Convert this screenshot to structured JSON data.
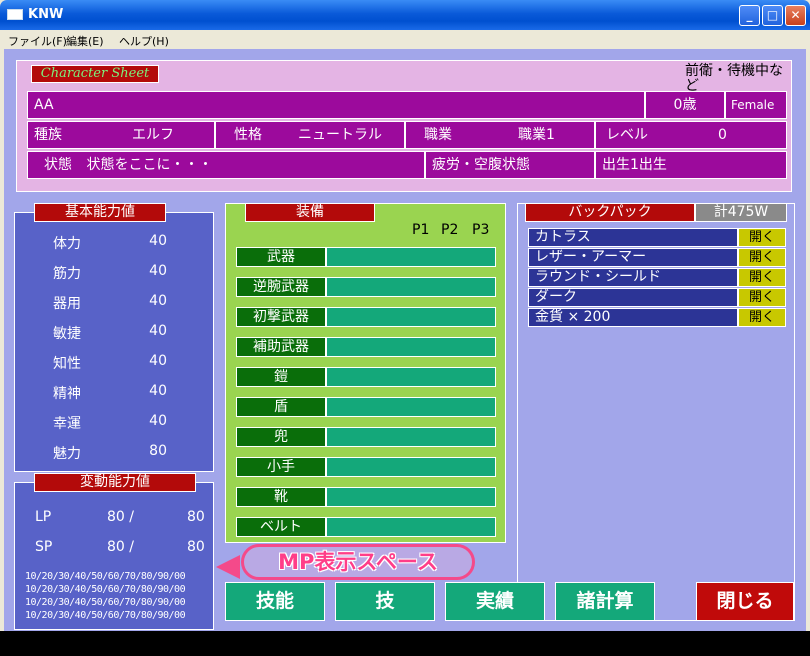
{
  "window": {
    "title": "KNW",
    "min": "_",
    "max": "□",
    "close": "✕"
  },
  "menu": {
    "file": "ファイル(F)",
    "edit": "編集(E)",
    "help": "ヘルプ(H)"
  },
  "character_sheet": {
    "header": "Character Sheet",
    "note": "前衛・待機中など",
    "name": "AA",
    "age": "0歳",
    "gender": "Female",
    "race_label": "種族",
    "race": "エルフ",
    "alignment_label": "性格",
    "alignment": "ニュートラル",
    "job_label": "職業",
    "job": "職業1",
    "level_label": "レベル",
    "level": "0",
    "status_label": "状態",
    "status": "状態をここに・・・",
    "fatigue": "疲労・空腹状態",
    "birth": "出生1出生"
  },
  "base_stats": {
    "header": "基本能力値",
    "items": [
      {
        "label": "体力",
        "value": "40"
      },
      {
        "label": "筋力",
        "value": "40"
      },
      {
        "label": "器用",
        "value": "40"
      },
      {
        "label": "敏捷",
        "value": "40"
      },
      {
        "label": "知性",
        "value": "40"
      },
      {
        "label": "精神",
        "value": "40"
      },
      {
        "label": "幸運",
        "value": "40"
      },
      {
        "label": "魅力",
        "value": "80"
      }
    ]
  },
  "var_stats": {
    "header": "変動能力値",
    "lp_label": "LP",
    "lp_cur": "80 /",
    "lp_max": "80",
    "sp_label": "SP",
    "sp_cur": "80 /",
    "sp_max": "80",
    "mp_lines": [
      "10/20/30/40/50/60/70/80/90/00",
      "10/20/30/40/50/60/70/80/90/00",
      "10/20/30/40/50/60/70/80/90/00",
      "10/20/30/40/50/60/70/80/90/00"
    ]
  },
  "equipment": {
    "header": "装備",
    "p1": "P1",
    "p2": "P2",
    "p3": "P3",
    "slots": [
      "武器",
      "逆腕武器",
      "初撃武器",
      "補助武器",
      "鎧",
      "盾",
      "兜",
      "小手",
      "靴",
      "ベルト"
    ]
  },
  "backpack": {
    "header": "バックパック",
    "total": "計475W",
    "open_label": "開く",
    "items": [
      "カトラス",
      "レザー・アーマー",
      "ラウンド・シールド",
      "ダーク",
      "金貨 × 200"
    ]
  },
  "annotation": {
    "mp_space": "MP表示スペース"
  },
  "buttons": {
    "skills": "技能",
    "techniques": "技",
    "achievements": "実績",
    "calc": "諸計算",
    "close": "閉じる"
  }
}
